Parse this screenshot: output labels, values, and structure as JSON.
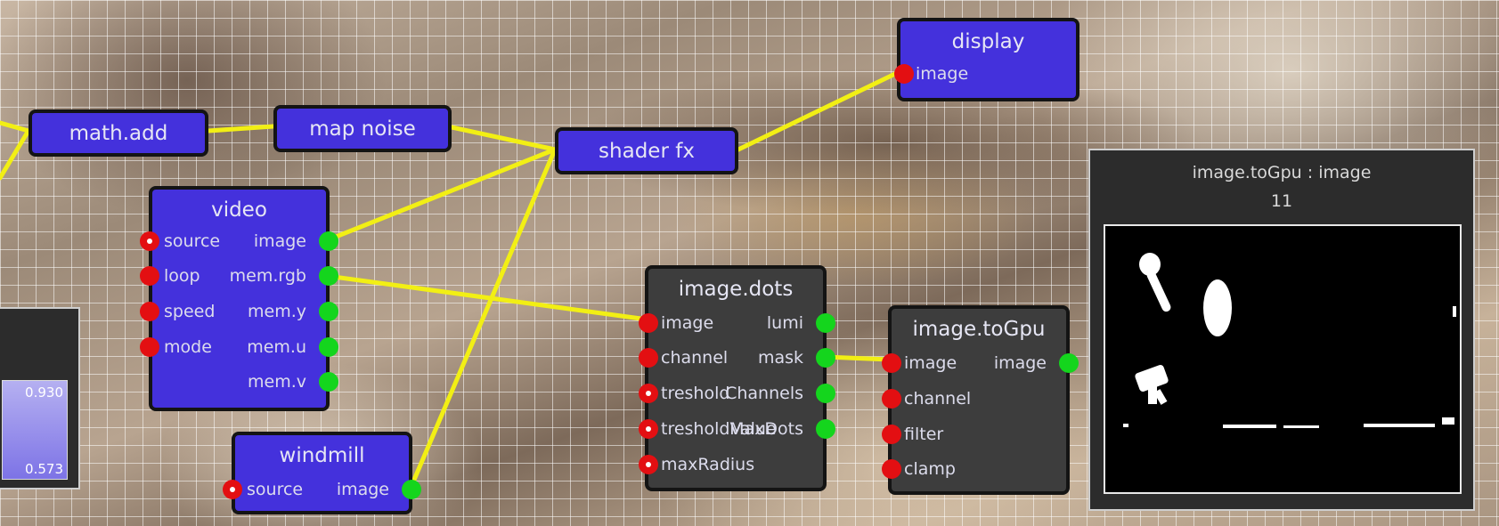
{
  "nodes": {
    "math_add": {
      "title": "math.add"
    },
    "map_noise": {
      "title": "map noise"
    },
    "shader_fx": {
      "title": "shader fx"
    },
    "display": {
      "title": "display",
      "inputs": [
        "image"
      ]
    },
    "video": {
      "title": "video",
      "inputs": [
        "source",
        "loop",
        "speed",
        "mode"
      ],
      "outputs": [
        "image",
        "mem.rgb",
        "mem.y",
        "mem.u",
        "mem.v"
      ]
    },
    "windmill": {
      "title": "windmill",
      "inputs": [
        "source"
      ],
      "outputs": [
        "image"
      ]
    },
    "image_dots": {
      "title": "image.dots",
      "inputs": [
        "image",
        "channel",
        "treshold",
        "tresholdValue",
        "maxRadius"
      ],
      "outputs": [
        "lumi",
        "mask",
        "Channels",
        "MaxDots"
      ]
    },
    "image_toGpu": {
      "title": "image.toGpu",
      "inputs": [
        "image",
        "channel",
        "filter",
        "clamp"
      ],
      "outputs": [
        "image"
      ]
    }
  },
  "preview_panel": {
    "title": "image.toGpu : image",
    "value": "11"
  },
  "left_panel": {
    "value_top": "0.930",
    "value_bottom": "0.573"
  },
  "colors": {
    "node_blue": "#4431dc",
    "node_gray": "#3d3d3d",
    "input_port": "#e30f12",
    "output_port": "#14d51d",
    "wire": "#f2ef14"
  }
}
